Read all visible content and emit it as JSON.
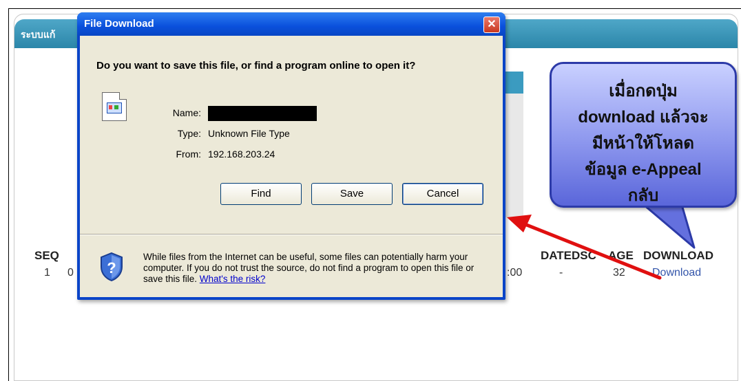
{
  "page": {
    "header_title": "ระบบแก้",
    "columns": {
      "seq": "SEQ",
      "datedsc": "DATEDSC",
      "age": "AGE",
      "download": "DOWNLOAD"
    },
    "row": {
      "seq": "1",
      "partial": "0",
      "time": ":00",
      "datedsc": "-",
      "age": "32",
      "download_link": "Download"
    }
  },
  "dialog": {
    "title": "File Download",
    "close_label": "✕",
    "question": "Do you want to save this file, or find a program online to open it?",
    "name_label": "Name:",
    "type_label": "Type:",
    "type_value": "Unknown File Type",
    "from_label": "From:",
    "from_value": "192.168.203.24",
    "buttons": {
      "find": "Find",
      "save": "Save",
      "cancel": "Cancel"
    },
    "warning": "While files from the Internet can be useful, some files can potentially harm your computer. If you do not trust the source, do not find a program to open this file or save this file. ",
    "risk_link": "What's the risk?"
  },
  "callout": {
    "line1": "เมื่อกดปุ่ม",
    "line2": "download แล้วจะ",
    "line3": "มีหน้าให้โหลด",
    "line4": "ข้อมูล e-Appeal",
    "line5": "กลับ"
  },
  "colors": {
    "titlebar": "#0a50dc",
    "header_bar": "#3b9bc0",
    "callout_fill": "#8d97ee",
    "arrow": "#e01010"
  }
}
